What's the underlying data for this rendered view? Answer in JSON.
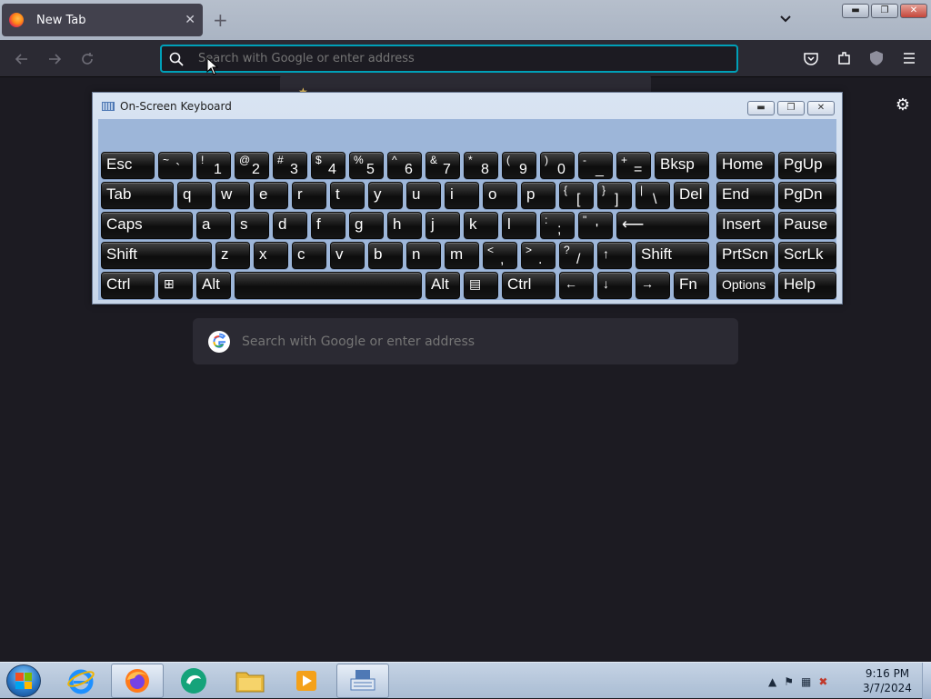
{
  "browser": {
    "tab_title": "New Tab",
    "tab_close": "✕",
    "new_tab": "+",
    "url_placeholder": "Search with Google or enter address",
    "page_search_placeholder": "Search with Google or enter address",
    "accent": "#00a0b8"
  },
  "window_controls": {
    "minimize": "▬",
    "maximize": "❐",
    "close": "✕"
  },
  "osk": {
    "title": "On-Screen Keyboard",
    "keys": {
      "esc": "Esc",
      "tilde": {
        "shift": "~",
        "base": "`"
      },
      "n1": {
        "shift": "!",
        "base": "1"
      },
      "n2": {
        "shift": "@",
        "base": "2"
      },
      "n3": {
        "shift": "#",
        "base": "3"
      },
      "n4": {
        "shift": "$",
        "base": "4"
      },
      "n5": {
        "shift": "%",
        "base": "5"
      },
      "n6": {
        "shift": "^",
        "base": "6"
      },
      "n7": {
        "shift": "&",
        "base": "7"
      },
      "n8": {
        "shift": "*",
        "base": "8"
      },
      "n9": {
        "shift": "(",
        "base": "9"
      },
      "n0": {
        "shift": ")",
        "base": "0"
      },
      "minus": {
        "shift": "-",
        "base": "_"
      },
      "equals": {
        "shift": "+",
        "base": "="
      },
      "bksp": "Bksp",
      "home": "Home",
      "pgup": "PgUp",
      "tab": "Tab",
      "q": "q",
      "w": "w",
      "e": "e",
      "r": "r",
      "t": "t",
      "y": "y",
      "u": "u",
      "i": "i",
      "o": "o",
      "p": "p",
      "lbracket": {
        "shift": "{",
        "base": "["
      },
      "rbracket": {
        "shift": "}",
        "base": "]"
      },
      "backslash": {
        "shift": "|",
        "base": "\\"
      },
      "del": "Del",
      "end": "End",
      "pgdn": "PgDn",
      "caps": "Caps",
      "a": "a",
      "s": "s",
      "d": "d",
      "f": "f",
      "g": "g",
      "h": "h",
      "j": "j",
      "k": "k",
      "l": "l",
      "semicolon": {
        "shift": ":",
        "base": ";"
      },
      "quote": {
        "shift": "\"",
        "base": "'"
      },
      "enter": "⟵",
      "insert": "Insert",
      "pause": "Pause",
      "lshift": "Shift",
      "z": "z",
      "x": "x",
      "c": "c",
      "v": "v",
      "b": "b",
      "n": "n",
      "m": "m",
      "comma": {
        "shift": "<",
        "base": ","
      },
      "period": {
        "shift": ">",
        "base": "."
      },
      "slash": {
        "shift": "?",
        "base": "/"
      },
      "up": "↑",
      "rshift": "Shift",
      "prtscn": "PrtScn",
      "scrlk": "ScrLk",
      "lctrl": "Ctrl",
      "win": "⊞",
      "lalt": "Alt",
      "space": "",
      "ralt": "Alt",
      "menu": "▤",
      "rctrl": "Ctrl",
      "left": "←",
      "down": "↓",
      "right": "→",
      "fn": "Fn",
      "options": "Options",
      "help": "Help"
    }
  },
  "taskbar": {
    "time": "9:16 PM",
    "date": "3/7/2024"
  }
}
